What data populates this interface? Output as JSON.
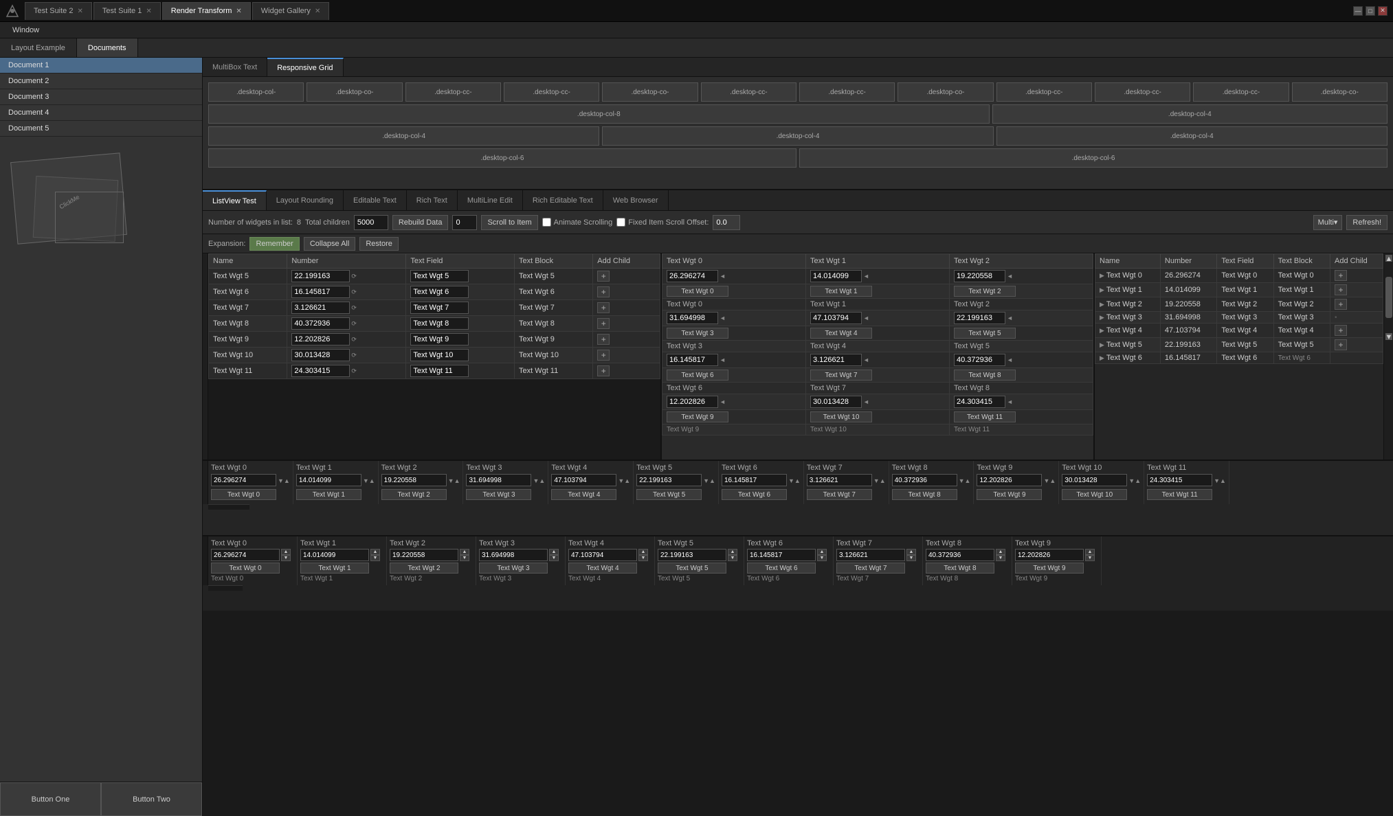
{
  "titlebar": {
    "tabs": [
      {
        "label": "Test Suite 2",
        "active": false
      },
      {
        "label": "Test Suite 1",
        "active": false
      },
      {
        "label": "Render Transform",
        "active": false
      },
      {
        "label": "Widget Gallery",
        "active": false
      }
    ],
    "window_controls": [
      "—",
      "□",
      "✕"
    ]
  },
  "menubar": {
    "items": [
      "Window"
    ]
  },
  "secondary_tabs": [
    {
      "label": "Layout Example",
      "active": false
    },
    {
      "label": "Documents",
      "active": true
    }
  ],
  "sidebar": {
    "items": [
      "Document 1",
      "Document 2",
      "Document 3",
      "Document 4",
      "Document 5"
    ],
    "buttons": [
      "Button One",
      "Button Two"
    ]
  },
  "content_tabs": [
    {
      "label": "MultiBox Text",
      "active": false
    },
    {
      "label": "Responsive Grid",
      "active": true
    }
  ],
  "grid_rows": [
    [
      ".desktop-col-",
      ".desktop-co-",
      ".desktop-cc-",
      ".desktop-cc-",
      ".desktop-co-",
      ".desktop-cc-",
      ".desktop-cc-",
      ".desktop-co-",
      ".desktop-cc-",
      ".desktop-cc-",
      ".desktop-cc-",
      ".desktop-co-"
    ],
    [
      ".desktop-col-8",
      ".desktop-col-4"
    ],
    [
      ".desktop-col-4",
      ".desktop-col-4",
      ".desktop-col-4"
    ],
    [
      ".desktop-col-6",
      ".desktop-col-6"
    ]
  ],
  "sub_tabs": [
    {
      "label": "ListView Test",
      "active": true
    },
    {
      "label": "Layout Rounding",
      "active": false
    },
    {
      "label": "Editable Text",
      "active": false
    },
    {
      "label": "Rich Text",
      "active": false
    },
    {
      "label": "MultiLine Edit",
      "active": false
    },
    {
      "label": "Rich Editable Text",
      "active": false
    },
    {
      "label": "Web Browser",
      "active": false
    }
  ],
  "toolbar": {
    "widgets_label": "Number of widgets in list:",
    "widgets_count": "8",
    "total_children_label": "Total children",
    "total_children_value": "5000",
    "rebuild_btn": "Rebuild Data",
    "zero_value": "0",
    "scroll_btn": "Scroll to Item",
    "animate_label": "Animate Scrolling",
    "fixed_label": "Fixed Item Scroll Offset:",
    "fixed_value": "0.0",
    "multi_btn": "Multi▾",
    "refresh_btn": "Refresh!"
  },
  "expansion": {
    "label": "Expansion:",
    "remember_btn": "Remember",
    "collapse_btn": "Collapse All",
    "restore_btn": "Restore"
  },
  "table_headers": [
    "Name",
    "Number",
    "Text Field",
    "Text Block",
    "Add Child"
  ],
  "table_rows": [
    {
      "name": "Text Wgt 5",
      "number": "22.199163",
      "text_field": "Text Wgt 5",
      "text_block": "Text Wgt 5",
      "add": "+"
    },
    {
      "name": "Text Wgt 6",
      "number": "16.145817",
      "text_field": "Text Wgt 6",
      "text_block": "Text Wgt 6",
      "add": "+"
    },
    {
      "name": "Text Wgt 7",
      "number": "3.126621",
      "text_field": "Text Wgt 7",
      "text_block": "Text Wgt 7",
      "add": "+"
    },
    {
      "name": "Text Wgt 8",
      "number": "40.372936",
      "text_field": "Text Wgt 8",
      "text_block": "Text Wgt 8",
      "add": "+"
    },
    {
      "name": "Text Wgt 9",
      "number": "12.202826",
      "text_field": "Text Wgt 9",
      "text_block": "Text Wgt 9",
      "add": "+"
    },
    {
      "name": "Text Wgt 10",
      "number": "30.013428",
      "text_field": "Text Wgt 10",
      "text_block": "Text Wgt 10",
      "add": "+"
    },
    {
      "name": "Text Wgt 11",
      "number": "24.303415",
      "text_field": "Text Wgt 11",
      "text_block": "Text Wgt 11",
      "add": "+"
    }
  ],
  "right_panel_headers": [
    "Name",
    "Number",
    "Text Field",
    "Text Block",
    "Add Child"
  ],
  "right_panel_rows": [
    {
      "prefix": "▶",
      "name": "Text Wgt 0",
      "number": "26.296274",
      "text_field": "Text Wgt 0"
    },
    {
      "prefix": "▶",
      "name": "Text Wgt 1",
      "number": "14.014099",
      "text_field": "Text Wgt 1"
    },
    {
      "prefix": "▶",
      "name": "Text Wgt 2",
      "number": "19.220558",
      "text_field": "Text Wgt 2"
    },
    {
      "prefix": "▶",
      "name": "Text Wgt 3",
      "number": "31.694998",
      "text_field": "Text Wgt 3"
    },
    {
      "prefix": "▶",
      "name": "Text Wgt 4",
      "number": "47.103794",
      "text_field": "Text Wgt 4"
    },
    {
      "prefix": "▶",
      "name": "Text Wgt 5",
      "number": "22.199163",
      "text_field": "Text Wgt 5"
    },
    {
      "prefix": "▶",
      "name": "Text Wgt 6",
      "number": "16.145817",
      "text_field": "Text Wgt 6"
    }
  ],
  "center_panel": {
    "row1_nums": [
      "26.296274",
      "14.014099",
      "19.220558"
    ],
    "row1_labels": [
      "Text Wgt 0",
      "Text Wgt 1",
      "Text Wgt 2"
    ],
    "row1_sub": [
      "Text Wgt 0",
      "Text Wgt 1",
      "Text Wgt 2"
    ],
    "row2_nums": [
      "31.694998",
      "47.103794",
      "22.199163"
    ],
    "row2_labels": [
      "Text Wgt 3",
      "Text Wgt 4",
      "Text Wgt 5"
    ],
    "row2_sub": [
      "Text Wgt 3",
      "Text Wgt 4",
      "Text Wgt 5"
    ],
    "row3_nums": [
      "16.145817",
      "3.126621",
      "40.372936"
    ],
    "row3_labels": [
      "Text Wgt 6",
      "Text Wgt 7",
      "Text Wgt 8"
    ],
    "row3_sub": [
      "Text Wgt 6",
      "Text Wgt 7",
      "Text Wgt 8"
    ],
    "row4_nums": [
      "12.202826",
      "30.013428",
      "24.303415"
    ],
    "row4_labels": [
      "Text Wgt 9",
      "Text Wgt 10",
      "Text Wgt 11"
    ],
    "row4_sub": [
      "Text Wgt 9",
      "Text Wgt 10",
      "Text Wgt 11"
    ]
  },
  "bottom_cols": [
    {
      "header": "Text Wgt 0",
      "num": "26.296274",
      "btn": "Text Wgt 0"
    },
    {
      "header": "Text Wgt 1",
      "num": "14.014099",
      "btn": "Text Wgt 1"
    },
    {
      "header": "Text Wgt 2",
      "num": "19.220558",
      "btn": "Text Wgt 2"
    },
    {
      "header": "Text Wgt 3",
      "num": "31.694998",
      "btn": "Text Wgt 3"
    },
    {
      "header": "Text Wgt 4",
      "num": "47.103794",
      "btn": "Text Wgt 4"
    },
    {
      "header": "Text Wgt 5",
      "num": "22.199163",
      "btn": "Text Wgt 5"
    },
    {
      "header": "Text Wgt 6",
      "num": "16.145817",
      "btn": "Text Wgt 6"
    },
    {
      "header": "Text Wgt 7",
      "num": "3.126621",
      "btn": "Text Wgt 7"
    },
    {
      "header": "Text Wgt 8",
      "num": "40.372936",
      "btn": "Text Wgt 8"
    },
    {
      "header": "Text Wgt 9",
      "num": "12.202826",
      "btn": "Text Wgt 9"
    },
    {
      "header": "Text Wgt 10",
      "num": "30.013428",
      "btn": "Text Wgt 10"
    },
    {
      "header": "Text Wgt 11",
      "num": "24.303415",
      "btn": "Text Wgt 11"
    }
  ],
  "bottom2_cols": [
    {
      "header": "Text Wgt 0",
      "num": "26.296274",
      "btn": "Text Wgt 0",
      "sub": "Text Wgt 0"
    },
    {
      "header": "Text Wgt 1",
      "num": "14.014099",
      "btn": "Text Wgt 1",
      "sub": "Text Wgt 1"
    },
    {
      "header": "Text Wgt 2",
      "num": "19.220558",
      "btn": "Text Wgt 2",
      "sub": "Text Wgt 2"
    },
    {
      "header": "Text Wgt 3",
      "num": "31.694998",
      "btn": "Text Wgt 3",
      "sub": "Text Wgt 3"
    },
    {
      "header": "Text Wgt 4",
      "num": "47.103794",
      "btn": "Text Wgt 4",
      "sub": "Text Wgt 4"
    },
    {
      "header": "Text Wgt 5",
      "num": "22.199163",
      "btn": "Text Wgt 5",
      "sub": "Text Wgt 5"
    },
    {
      "header": "Text Wgt 6",
      "num": "16.145817",
      "btn": "Text Wgt 6",
      "sub": "Text Wgt 6"
    },
    {
      "header": "Text Wgt 7",
      "num": "3.126621",
      "btn": "Text Wgt 7",
      "sub": "Text Wgt 7"
    },
    {
      "header": "Text Wgt 8",
      "num": "40.372936",
      "btn": "Text Wgt 8",
      "sub": "Text Wgt 8"
    },
    {
      "header": "Text Wgt 9",
      "num": "12.202826",
      "btn": "Text Wgt 9",
      "sub": "Text Wgt 9"
    }
  ]
}
